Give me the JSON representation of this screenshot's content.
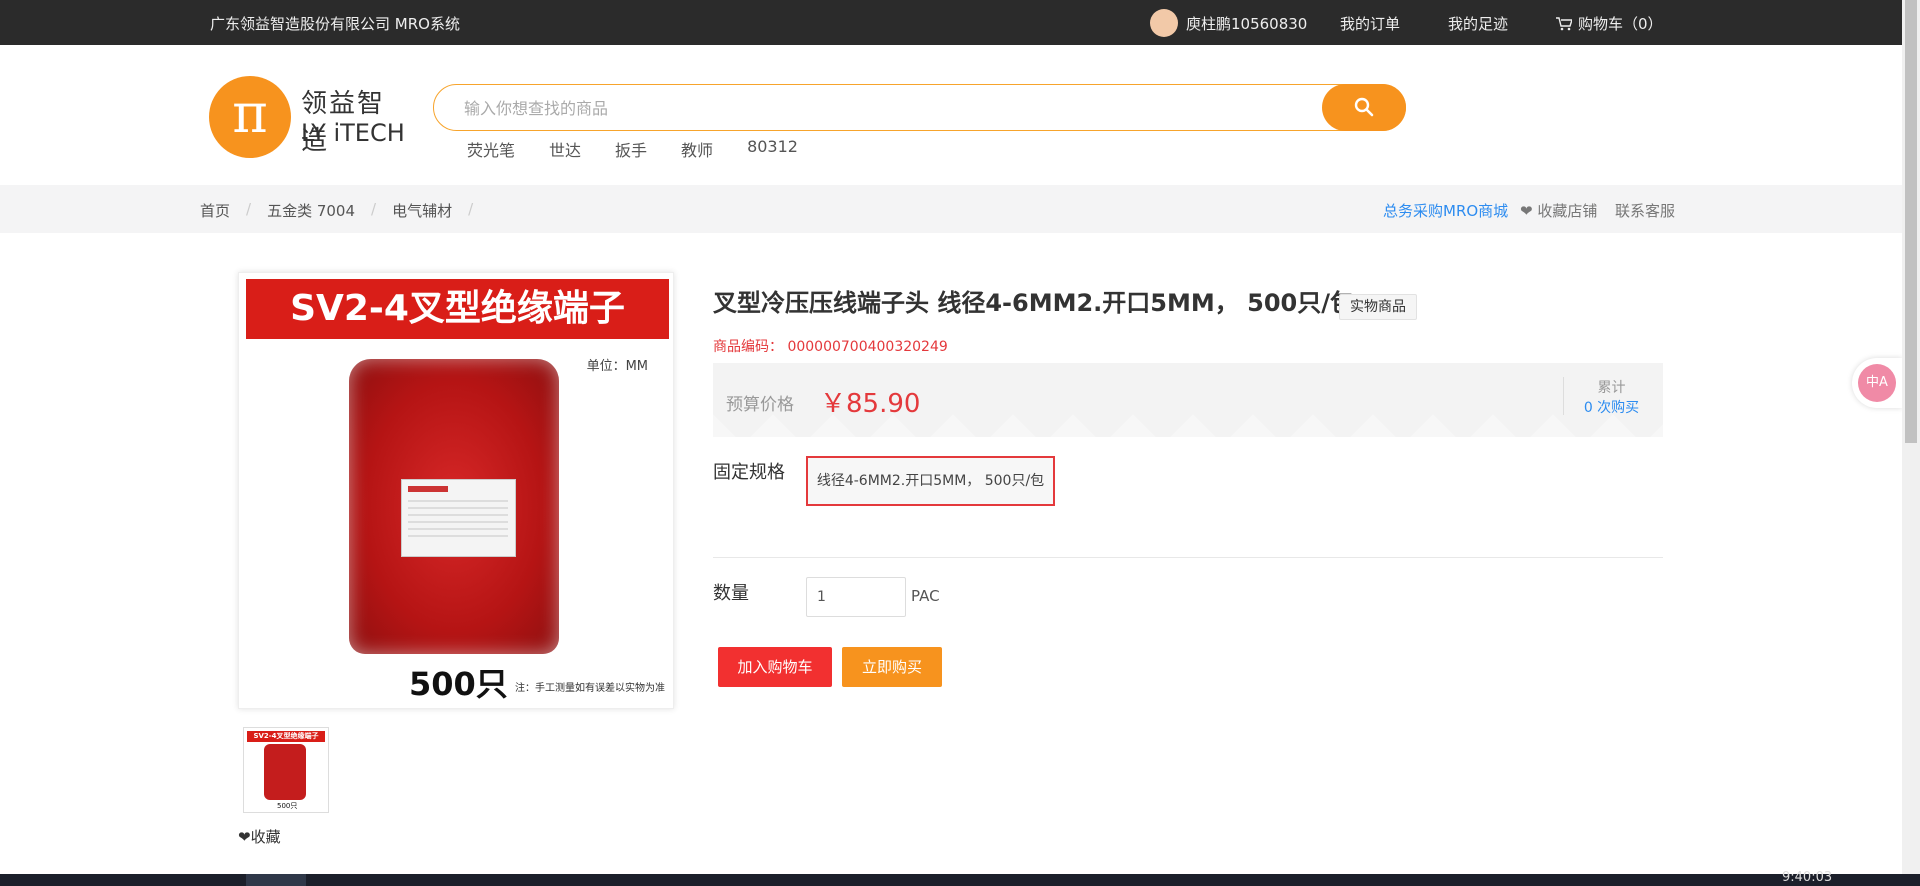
{
  "topbar": {
    "company": "广东领益智造股份有限公司 MRO系统",
    "user": "庾柱鹏10560830",
    "my_orders": "我的订单",
    "my_footprints": "我的足迹",
    "cart": "购物车（0）"
  },
  "logo": {
    "cn": "领益智造",
    "en": "LY iTECH",
    "mark": "π"
  },
  "search": {
    "placeholder": "输入你想查找的商品",
    "hot_words": [
      "荧光笔",
      "世达",
      "扳手",
      "教师",
      "80312"
    ]
  },
  "breadcrumb": {
    "items": [
      "首页",
      "五金类 7004",
      "电气辅材"
    ],
    "mro_link": "总务采购MRO商城",
    "favorite_shop": "收藏店铺",
    "contact_service": "联系客服"
  },
  "product": {
    "title": "叉型冷压压线端子头 线径4-6MM2.开口5MM， 500只/包",
    "badge": "实物商品",
    "code": "商品编码： 000000700400320249",
    "price_label": "预算价格",
    "price": "￥85.90",
    "accum_label": "累计",
    "accum_value": "0 次购买",
    "spec_label": "固定规格",
    "spec_option": "线径4-6MM2.开口5MM， 500只/包",
    "qty_label": "数量",
    "qty_value": "1",
    "qty_unit": "PAC",
    "add_to_cart": "加入购物车",
    "buy_now": "立即购买",
    "favorite": "❤收藏"
  },
  "image": {
    "banner": "SV2-4叉型绝缘端子",
    "unit": "单位：MM",
    "count": "500只",
    "note": "注：手工测量如有误差以实物为准"
  },
  "widget": {
    "translate": "中A"
  },
  "taskbar": {
    "clock": "9:40:03"
  }
}
